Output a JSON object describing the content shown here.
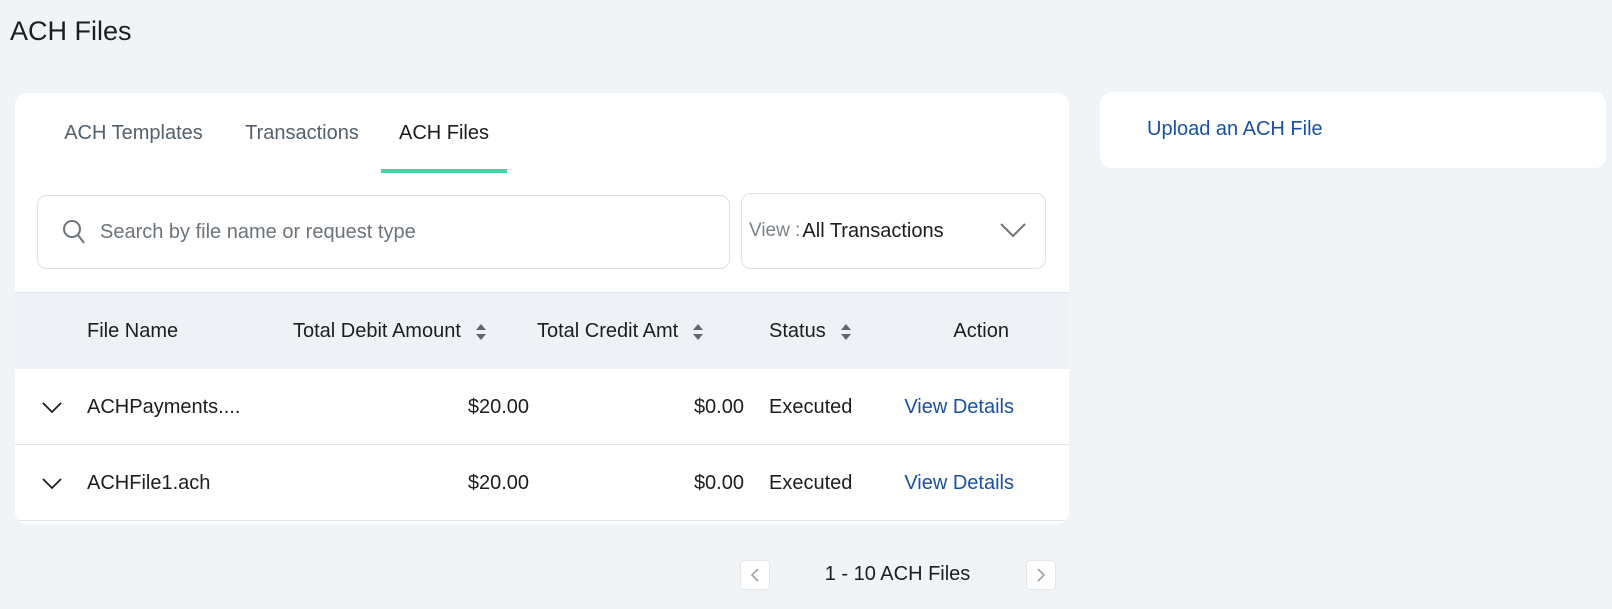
{
  "page": {
    "title": "ACH Files"
  },
  "tabs": [
    {
      "label": "ACH Templates",
      "active": false
    },
    {
      "label": "Transactions",
      "active": false
    },
    {
      "label": "ACH Files",
      "active": true
    }
  ],
  "search": {
    "placeholder": "Search by file name or request type",
    "value": ""
  },
  "view_filter": {
    "label": "View :",
    "selected": "All Transactions"
  },
  "table": {
    "columns": [
      "File Name",
      "Total Debit Amount",
      "Total Credit Amt",
      "Status",
      "Action"
    ],
    "rows": [
      {
        "file_name": "ACHPayments....",
        "total_debit": "$20.00",
        "total_credit": "$0.00",
        "status": "Executed",
        "action": "View Details"
      },
      {
        "file_name": "ACHFile1.ach",
        "total_debit": "$20.00",
        "total_credit": "$0.00",
        "status": "Executed",
        "action": "View Details"
      }
    ]
  },
  "upload": {
    "label": "Upload an ACH File"
  },
  "pagination": {
    "text": "1 - 10 ACH Files"
  },
  "colors": {
    "accent": "#3ed6a3",
    "link": "#1a4fa8",
    "background": "#f1f4f7"
  },
  "icons": [
    "search-icon",
    "chevron-down-icon",
    "sort-icon",
    "expand-chevron-icon",
    "chevron-left-icon",
    "chevron-right-icon"
  ]
}
